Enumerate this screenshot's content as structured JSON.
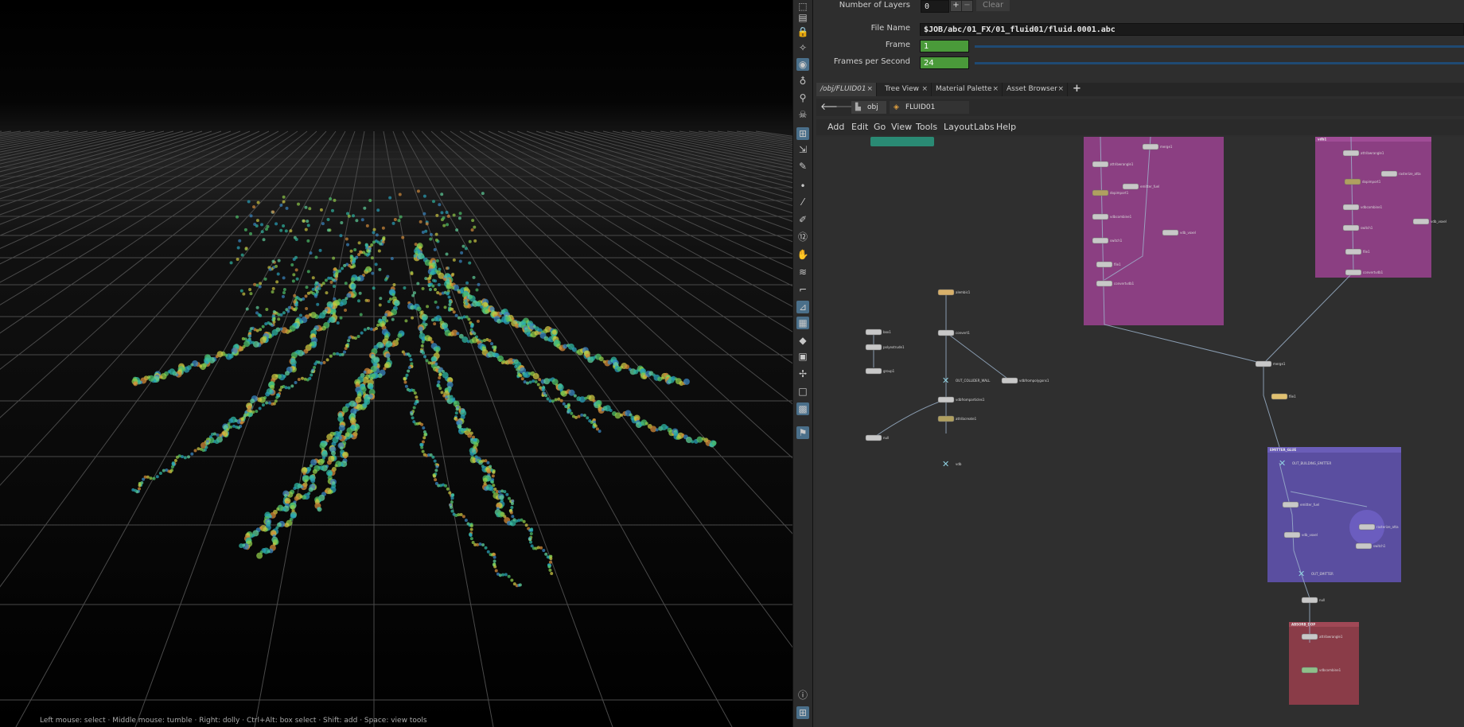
{
  "parameters": {
    "layers_label": "Number of Layers",
    "layers_value": "0",
    "plus": "+",
    "minus": "−",
    "clear": "Clear",
    "file_name_label": "File Name",
    "file_name_value": "$JOB/abc/01_FX/01_fluid01/fluid.0001.abc",
    "frame_label": "Frame",
    "frame_value": "1",
    "fps_label": "Frames per Second",
    "fps_value": "24"
  },
  "tabs": [
    {
      "label": "/obj/FLUID01"
    },
    {
      "label": "Tree View"
    },
    {
      "label": "Material Palette"
    },
    {
      "label": "Asset Browser"
    }
  ],
  "tab_close": "×",
  "tab_add": "+",
  "path": {
    "root": "obj",
    "current": "FLUID01"
  },
  "menu": [
    "Add",
    "Edit",
    "Go",
    "View",
    "Tools",
    "Layout",
    "Labs",
    "Help"
  ],
  "network": {
    "nodes": {
      "out_collider": "OUT_COLLIDER_WALL",
      "null_out": "OUT_BUILDING_EMITTER",
      "out_emitter": "OUT_EMITTER",
      "n1": "alembic1",
      "n2": "convert1",
      "n3": "box1",
      "n4": "polyextrude1",
      "n5": "group1",
      "n6": "vdbfrompolygons1",
      "n7": "vdbfromparticles1",
      "n8": "attribcreate1",
      "n9": "null",
      "n10": "merge1",
      "n11": "convertvdb1",
      "n12": "vdb",
      "n13": "attribwrangle1",
      "n14": "dopimport1",
      "n15": "vdbcombine1",
      "n16": "switch1",
      "n17": "file1",
      "n18": "emitter_fuel",
      "n19": "vdb_voxel",
      "n20": "rasterize_atta"
    },
    "boxes": {
      "emitter": "EMITTER_GLUE",
      "pink_right": "vdb1",
      "red": "ABSORB_DOP"
    },
    "colors": {
      "pink": "#8b3f82",
      "purple": "#5a4ea0",
      "red": "#8a3c48",
      "teal": "#2a8a74"
    }
  },
  "status_text": "Left mouse: select  ·  Middle mouse: tumble  ·  Right: dolly  ·  Ctrl+Alt: box select  ·  Shift: add  ·  Space: view tools",
  "icons": [
    "select-icon",
    "lock-icon",
    "ghost-icon",
    "view-icon",
    "light-icon",
    "bulb-icon",
    "skull-icon",
    "handle-icon",
    "pose-icon",
    "edit-icon",
    "point-icon",
    "brush-icon",
    "pen-icon",
    "numbered-icon",
    "hand-icon",
    "paint-icon",
    "frame-icon",
    "snap-icon",
    "grid-icon",
    "diamond-icon",
    "image-icon",
    "axis-icon",
    "square-icon",
    "camera-icon",
    "pin-icon",
    "info-icon",
    "layout-icon"
  ]
}
